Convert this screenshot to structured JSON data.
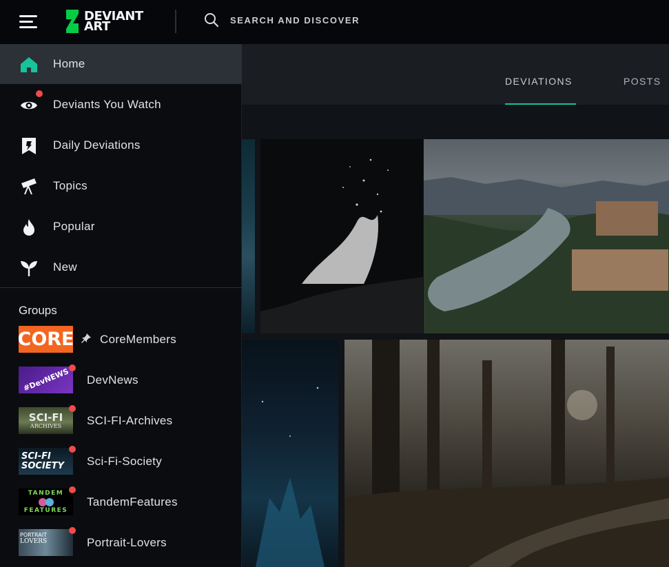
{
  "header": {
    "logo_line1": "DEVIANT",
    "logo_line2": "ART",
    "search_label": "SEARCH AND DISCOVER"
  },
  "tabs": [
    {
      "label": "DEVIATIONS",
      "active": true
    },
    {
      "label": "POSTS",
      "active": false
    }
  ],
  "sidebar": {
    "nav": [
      {
        "label": "Home",
        "icon": "home-icon",
        "active": true
      },
      {
        "label": "Deviants You Watch",
        "icon": "eye-icon",
        "notification": true
      },
      {
        "label": "Daily Deviations",
        "icon": "daily-deviation-icon"
      },
      {
        "label": "Topics",
        "icon": "telescope-icon"
      },
      {
        "label": "Popular",
        "icon": "flame-icon"
      },
      {
        "label": "New",
        "icon": "sprout-icon"
      }
    ],
    "groups_title": "Groups",
    "groups": [
      {
        "label": "CoreMembers",
        "thumb_text": "CORE",
        "pinned": true
      },
      {
        "label": "DevNews",
        "thumb_text": "#DevNEWS",
        "notification": true
      },
      {
        "label": "SCI-FI-Archives",
        "thumb_text": "SCI-FI",
        "thumb_sub": "ARCHIVES",
        "notification": true
      },
      {
        "label": "Sci-Fi-Society",
        "thumb_text": "SCI-FI",
        "thumb_sub": "SOCIETY",
        "notification": true
      },
      {
        "label": "TandemFeatures",
        "thumb_text": "TANDEM",
        "thumb_sub": "FEATURES",
        "notification": true
      },
      {
        "label": "Portrait-Lovers",
        "thumb_text": "PORTRAIT",
        "thumb_sub": "LOVERS",
        "notification": true
      }
    ]
  },
  "colors": {
    "accent": "#16c39b",
    "notification": "#f04a4a",
    "core_orange": "#f26622",
    "devnews_purple": "#6a2fb0"
  }
}
